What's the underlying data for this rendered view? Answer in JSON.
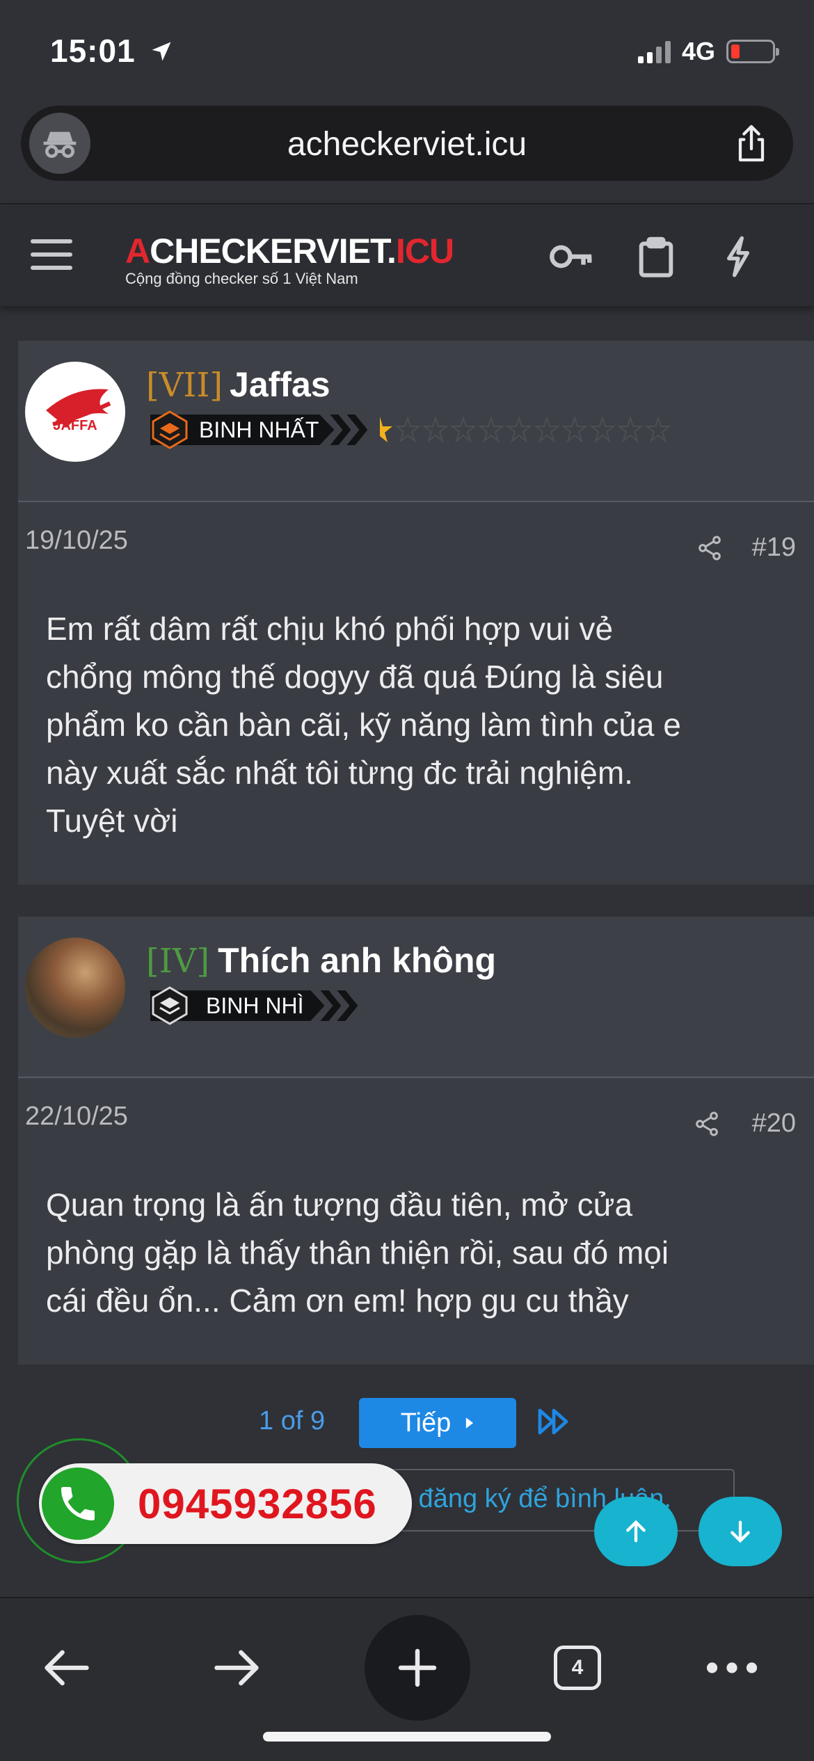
{
  "status_bar": {
    "time": "15:01",
    "network": "4G"
  },
  "browser": {
    "url": "acheckerviet.icu",
    "tab_count": "4"
  },
  "site": {
    "logo_prefix": "A",
    "logo_middle": "CHECKERVIET.",
    "logo_suffix": "ICU",
    "tagline": "Cộng đồng checker số 1 Việt Nam"
  },
  "posts": [
    {
      "rank": "[VII]",
      "rank_color": "#c98c2a",
      "username": "Jaffas",
      "badge": "BINH NHẤT",
      "avatar_text": "JAFFA",
      "date": "19/10/25",
      "number": "#19",
      "body_lines": [
        "Em rất dâm rất chịu khó phối hợp vui vẻ",
        "chổng mông thế dogyy đã quá Đúng là siêu",
        "phẩm ko cần bàn cãi, kỹ năng làm tình của e",
        "này xuất sắc nhất tôi từng đc trải nghiệm.",
        "Tuyệt vời"
      ]
    },
    {
      "rank": "[IV]",
      "rank_color": "#4f9a43",
      "username": "Thích anh không",
      "badge": "BINH NHÌ",
      "date": "22/10/25",
      "number": "#20",
      "body_lines": [
        "Quan trọng là ấn tượng đầu tiên, mở cửa",
        "phòng gặp là thấy thân thiện rồi, sau đó mọi",
        "cái đều ổn... Cảm ơn em! hợp gu cu thầy"
      ]
    }
  ],
  "pagination": {
    "info": "1 of 9",
    "next_label": "Tiếp"
  },
  "comment": {
    "placeholder": "c đăng ký để bình luận."
  },
  "hotline": {
    "number": "0945932856"
  },
  "colors": {
    "accent": "#1e88e5",
    "fab": "#17b3cf",
    "phone_green": "#21a52b",
    "phone_red": "#e0161f",
    "logo_red": "#e2262f"
  },
  "icons": [
    "navigation-arrow-icon",
    "incognito-icon",
    "share-icon",
    "menu-icon",
    "key-icon",
    "clipboard-icon",
    "bolt-icon",
    "phone-icon",
    "arrow-up-icon",
    "arrow-down-icon",
    "back-icon",
    "forward-icon",
    "plus-icon",
    "tabs-icon",
    "more-icon"
  ]
}
